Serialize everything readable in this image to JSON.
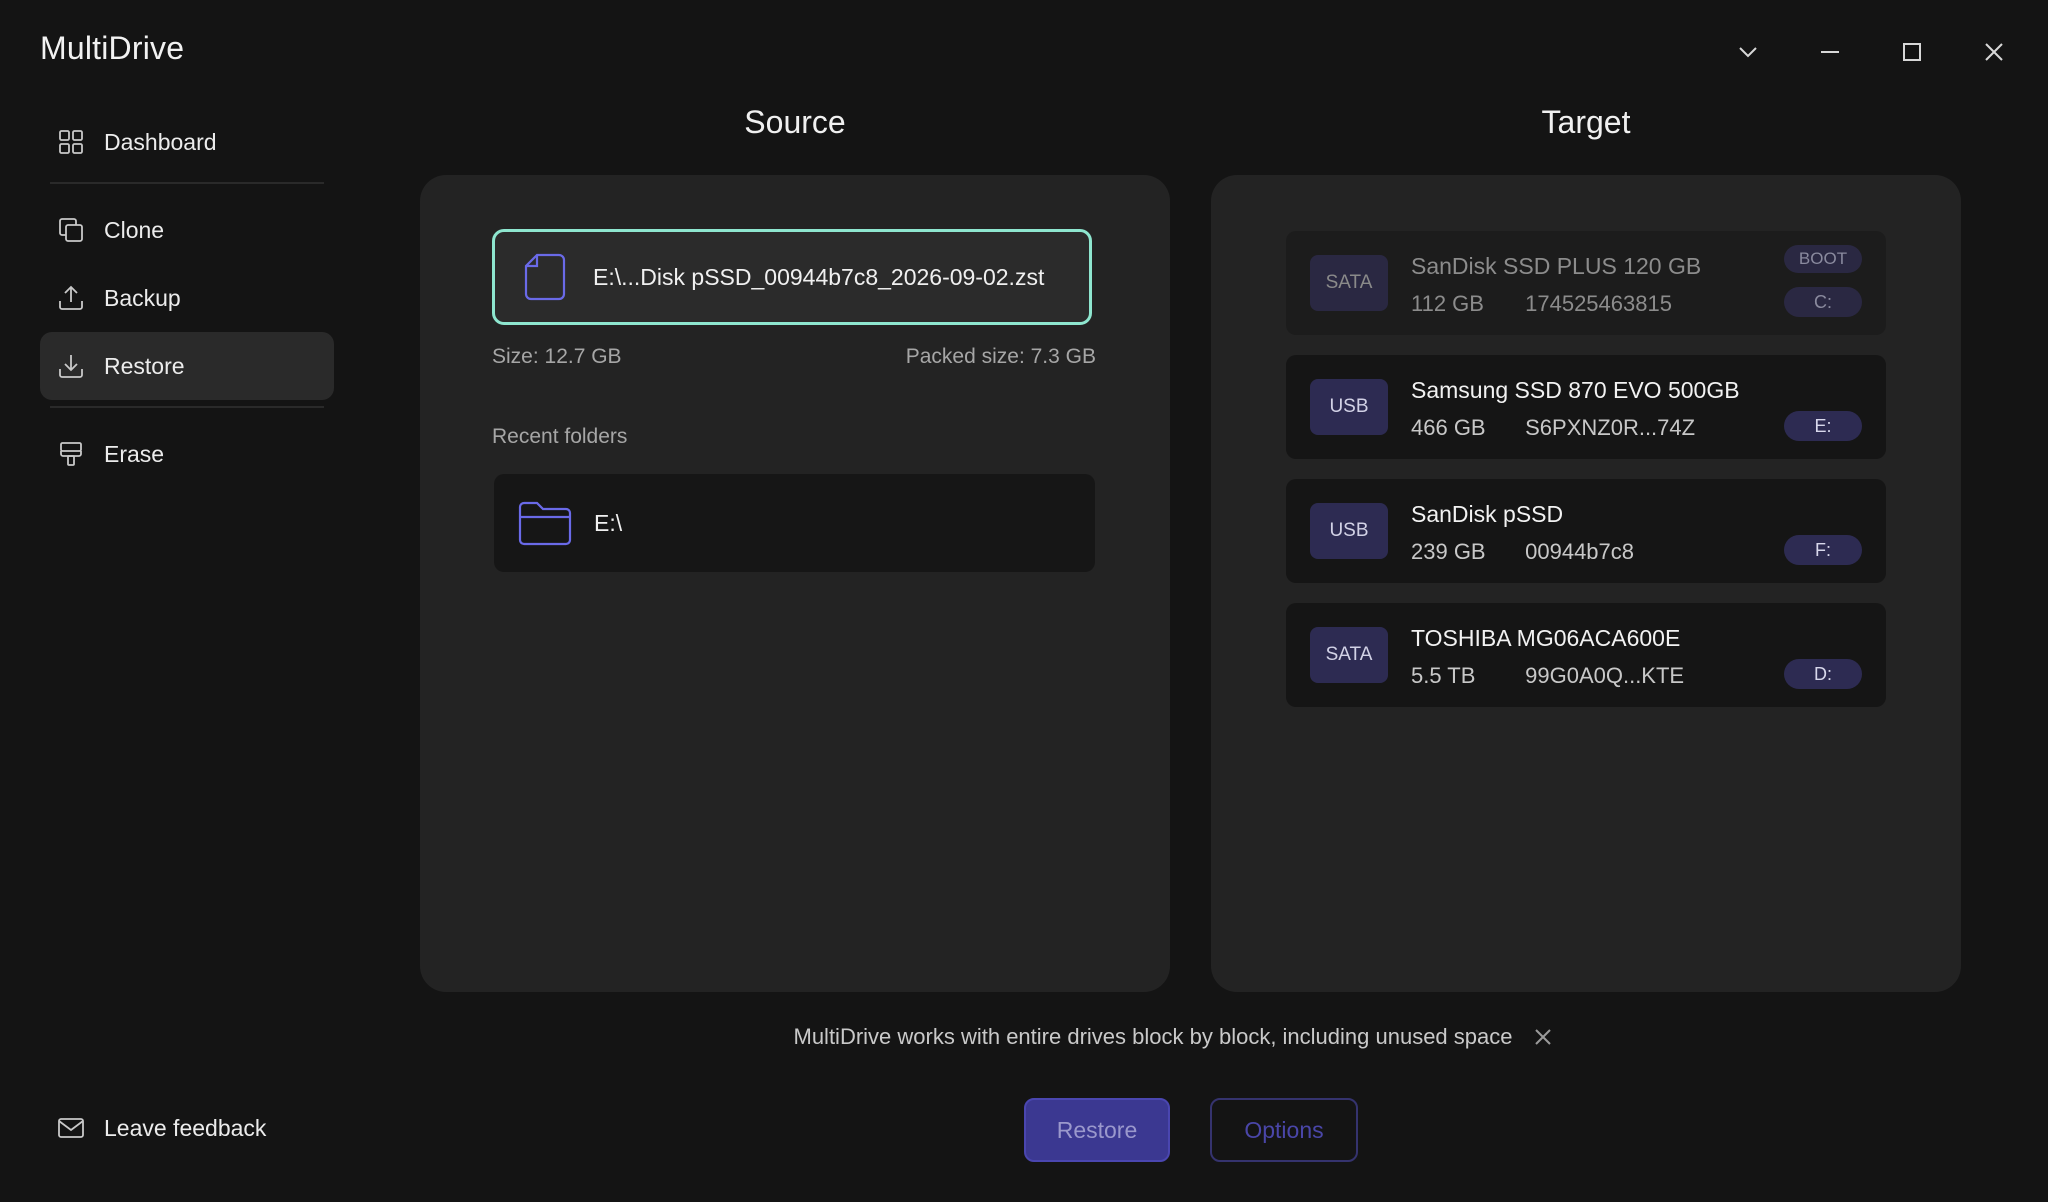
{
  "app": {
    "title": "MultiDrive"
  },
  "window_controls": {
    "dropdown_icon": "chevron-down-icon",
    "minimize_icon": "minimize-icon",
    "maximize_icon": "maximize-icon",
    "close_icon": "close-icon"
  },
  "sidebar": {
    "items": [
      {
        "label": "Dashboard",
        "icon": "grid-icon"
      },
      {
        "label": "Clone",
        "icon": "copy-icon"
      },
      {
        "label": "Backup",
        "icon": "upload-icon"
      },
      {
        "label": "Restore",
        "icon": "download-icon",
        "active": true
      },
      {
        "label": "Erase",
        "icon": "paint-brush-icon"
      }
    ],
    "feedback_label": "Leave feedback"
  },
  "source": {
    "heading": "Source",
    "file_name": "E:\\...Disk pSSD_00944b7c8_2026-09-02.zst",
    "size": "Size: 12.7 GB",
    "packed_size": "Packed size: 7.3 GB",
    "recent_label": "Recent folders",
    "recent_folders": [
      {
        "name": "E:\\"
      }
    ]
  },
  "target": {
    "heading": "Target",
    "drives": [
      {
        "bus": "SATA",
        "name": "SanDisk SSD PLUS 120 GB",
        "capacity": "112 GB",
        "serial": "174525463815",
        "letter": "C:",
        "badge": "BOOT"
      },
      {
        "bus": "USB",
        "name": "Samsung SSD 870 EVO 500GB",
        "capacity": "466 GB",
        "serial": "S6PXNZ0R...74Z",
        "letter": "E:"
      },
      {
        "bus": "USB",
        "name": "SanDisk pSSD",
        "capacity": "239 GB",
        "serial": "00944b7c8",
        "letter": "F:"
      },
      {
        "bus": "SATA",
        "name": "TOSHIBA MG06ACA600E",
        "capacity": "5.5 TB",
        "serial": "99G0A0Q...KTE",
        "letter": "D:"
      }
    ]
  },
  "info": {
    "text": "MultiDrive works with entire drives block by block, including unused space"
  },
  "actions": {
    "restore_label": "Restore",
    "options_label": "Options"
  },
  "colors": {
    "background": "#141414",
    "panel": "#232323",
    "accent": "#3b3891",
    "selected_border": "#8ee6cf"
  }
}
